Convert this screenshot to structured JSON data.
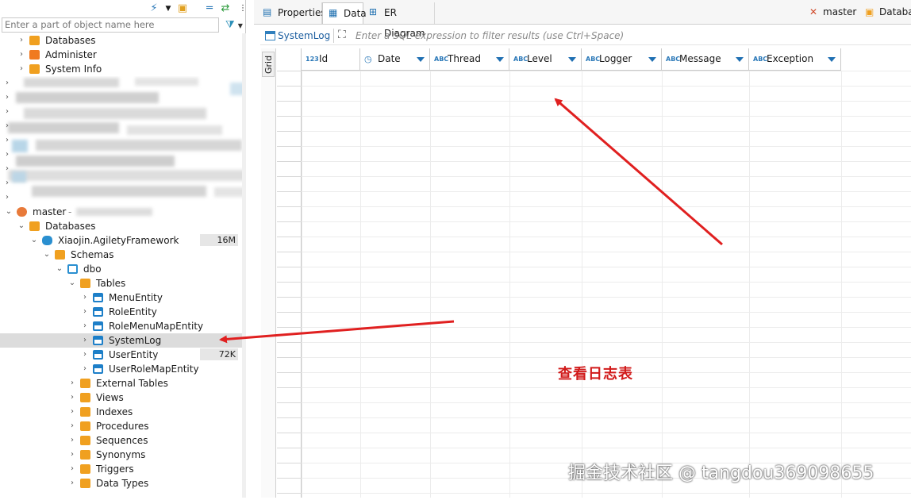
{
  "navigator": {
    "filter_placeholder": "Enter a part of object name here",
    "tree": [
      {
        "label": "Databases",
        "icon": "folder-icon"
      },
      {
        "label": "Administer",
        "icon": "administer-icon"
      },
      {
        "label": "System Info",
        "icon": "info-icon"
      },
      {
        "label": "master",
        "icon": "connection-icon"
      },
      {
        "label": "Databases",
        "icon": "folder-icon"
      },
      {
        "label": "Xiaojin.AgiletyFramework",
        "icon": "database-icon",
        "badge": "16M"
      },
      {
        "label": "Schemas",
        "icon": "folder-icon"
      },
      {
        "label": "dbo",
        "icon": "schema-icon"
      },
      {
        "label": "Tables",
        "icon": "folder-icon"
      },
      {
        "label": "MenuEntity",
        "icon": "table-icon"
      },
      {
        "label": "RoleEntity",
        "icon": "table-icon"
      },
      {
        "label": "RoleMenuMapEntity",
        "icon": "table-icon"
      },
      {
        "label": "SystemLog",
        "icon": "table-icon"
      },
      {
        "label": "UserEntity",
        "icon": "table-icon",
        "badge": "72K"
      },
      {
        "label": "UserRoleMapEntity",
        "icon": "table-icon"
      },
      {
        "label": "External Tables",
        "icon": "folder-icon"
      },
      {
        "label": "Views",
        "icon": "folder-icon"
      },
      {
        "label": "Indexes",
        "icon": "folder-icon"
      },
      {
        "label": "Procedures",
        "icon": "folder-icon"
      },
      {
        "label": "Sequences",
        "icon": "folder-icon"
      },
      {
        "label": "Synonyms",
        "icon": "folder-icon"
      },
      {
        "label": "Triggers",
        "icon": "folder-icon"
      },
      {
        "label": "Data Types",
        "icon": "folder-icon"
      }
    ]
  },
  "editor": {
    "tabs": [
      {
        "label": "Properties",
        "icon": "properties-icon"
      },
      {
        "label": "Data",
        "icon": "data-icon"
      },
      {
        "label": "ER Diagram",
        "icon": "er-diagram-icon"
      }
    ],
    "active_tab": "Data",
    "connection_label": "master",
    "database_label": "Databa",
    "table_name": "SystemLog",
    "sql_filter_placeholder": "Enter a SQL expression to filter results (use Ctrl+Space)",
    "grid_label": "Grid",
    "columns": [
      {
        "name": "Id",
        "type": "123"
      },
      {
        "name": "Date",
        "type": "clock"
      },
      {
        "name": "Thread",
        "type": "ABC"
      },
      {
        "name": "Level",
        "type": "ABC"
      },
      {
        "name": "Logger",
        "type": "ABC"
      },
      {
        "name": "Message",
        "type": "ABC"
      },
      {
        "name": "Exception",
        "type": "ABC"
      }
    ]
  },
  "annotation": "查看日志表",
  "watermark": "掘金技术社区 @ tangdou369098655",
  "colors": {
    "accent": "#1d6fb0",
    "folder": "#f0a020",
    "arrow": "#e02020"
  }
}
